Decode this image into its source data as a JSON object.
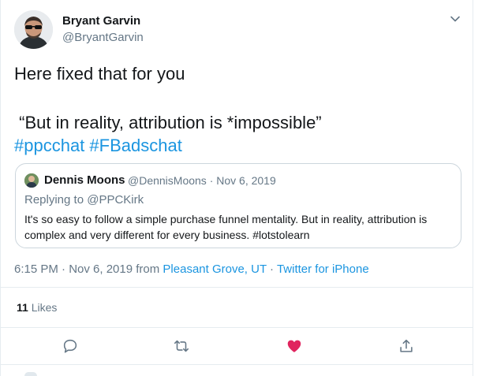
{
  "author": {
    "name": "Bryant Garvin",
    "handle": "@BryantGarvin"
  },
  "tweet": {
    "line1": "Here fixed that for you",
    "line2": " “But in reality, attribution is *impossible”",
    "hashtags": [
      "#ppcchat",
      "#FBadschat"
    ]
  },
  "quote": {
    "name": "Dennis Moons",
    "handle": "@DennisMoons · Nov 6, 2019",
    "replying_prefix": "Replying to ",
    "replying_to": "@PPCKirk",
    "text": "It's so easy to follow a simple purchase funnel mentality. But in reality, attribution is complex and very different for every business. #lotstolearn"
  },
  "meta": {
    "time_date": "6:15 PM · Nov 6, 2019 from ",
    "location": "Pleasant Grove, UT",
    "dot": " · ",
    "source": "Twitter for iPhone"
  },
  "likes": {
    "count": "11",
    "label": "Likes"
  },
  "actions": {
    "reply": "reply-icon",
    "retweet": "retweet-icon",
    "like": "heart-icon",
    "share": "share-icon"
  },
  "colors": {
    "link": "#1b95e0",
    "like": "#e0245e",
    "secondary": "#657786"
  }
}
